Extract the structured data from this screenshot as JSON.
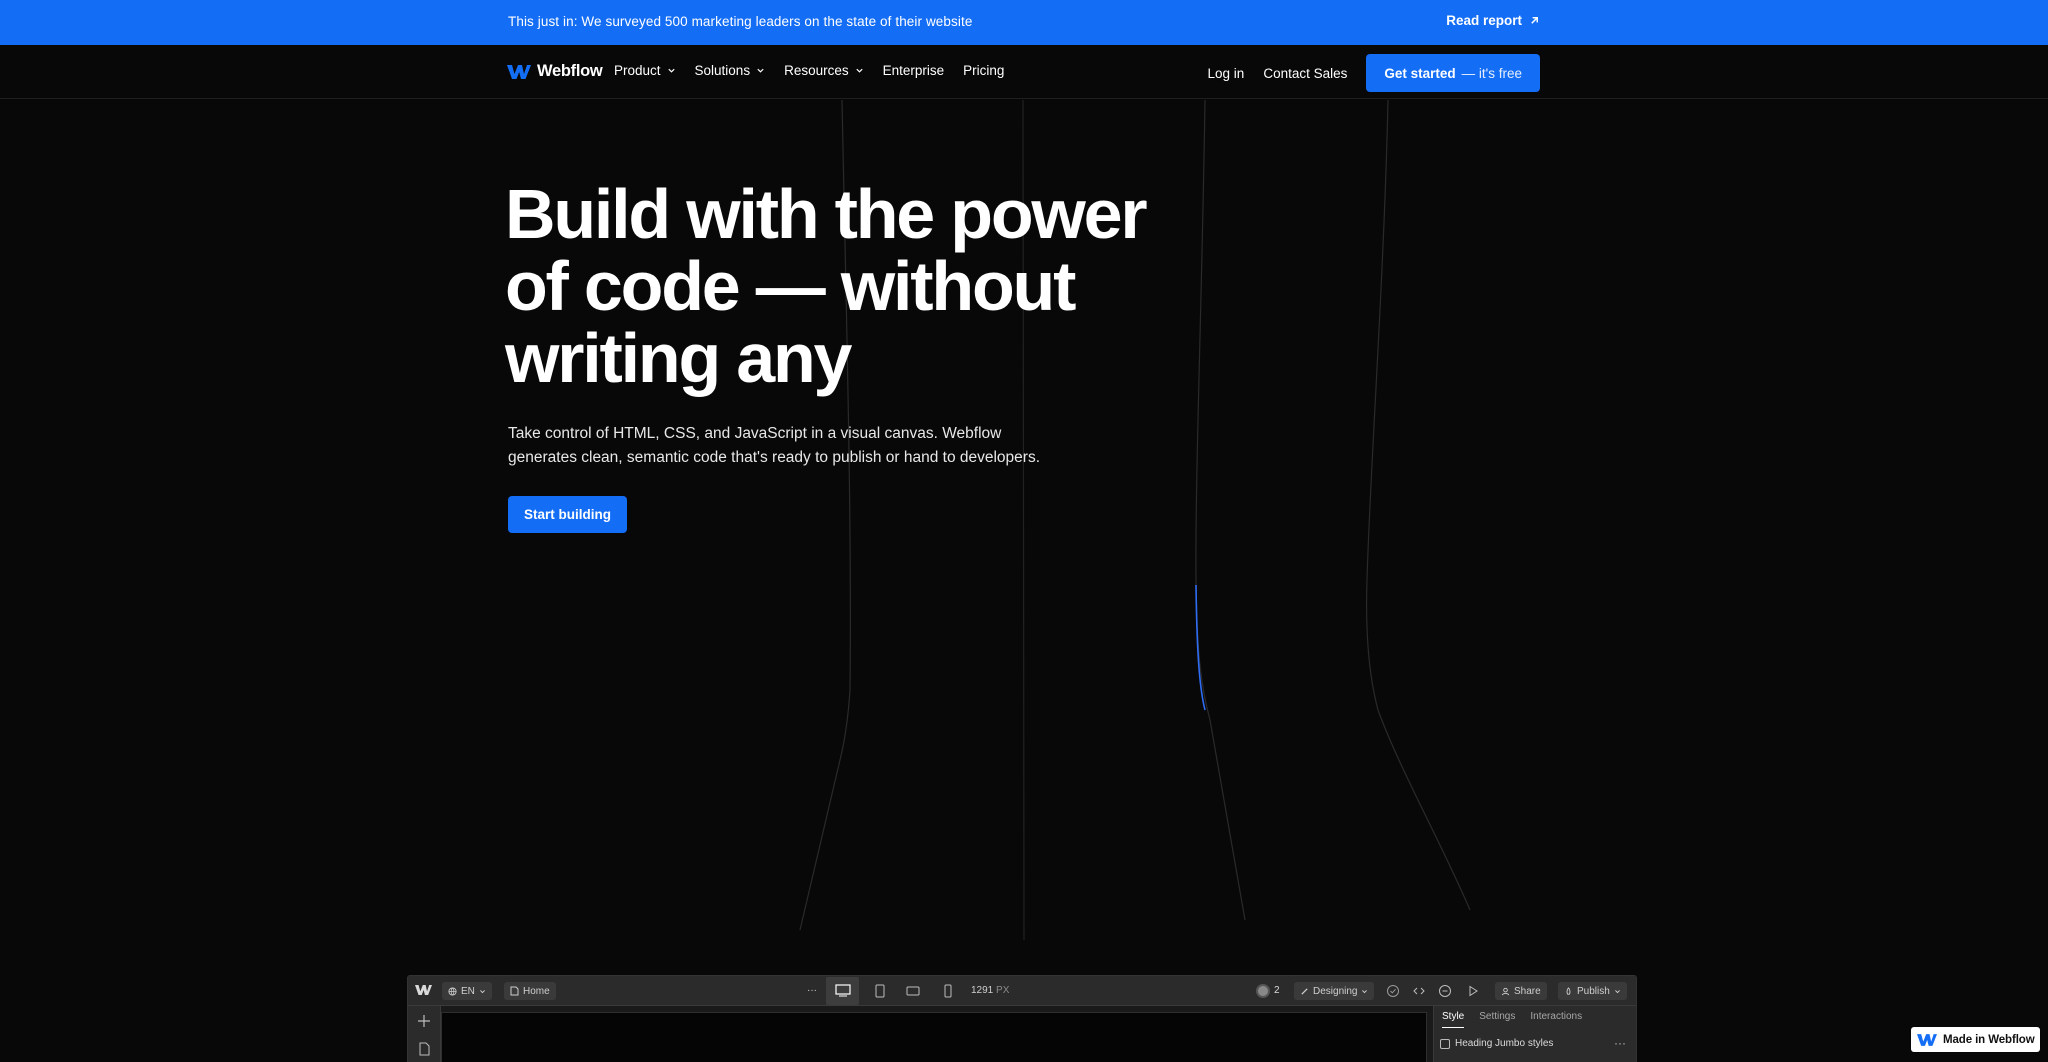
{
  "announcement": {
    "text": "This just in: We surveyed 500 marketing leaders on the state of their website",
    "link_label": "Read report",
    "link_icon": "arrow-up-right-icon"
  },
  "nav": {
    "brand": "Webflow",
    "items": [
      {
        "label": "Product",
        "has_dropdown": true
      },
      {
        "label": "Solutions",
        "has_dropdown": true
      },
      {
        "label": "Resources",
        "has_dropdown": true
      },
      {
        "label": "Enterprise",
        "has_dropdown": false
      },
      {
        "label": "Pricing",
        "has_dropdown": false
      }
    ],
    "login": "Log in",
    "contact": "Contact Sales",
    "cta_strong": "Get started",
    "cta_light": "— it's free"
  },
  "hero": {
    "title": "Build with the power\nof code — without\nwriting any",
    "subtitle": "Take control of HTML, CSS, and JavaScript in a visual canvas. Webflow generates clean, semantic code that's ready to publish or hand to developers.",
    "button": "Start building"
  },
  "designer": {
    "locale": "EN",
    "page": "Home",
    "more": "···",
    "width_value": "1291",
    "width_unit": "PX",
    "collaborators": "2",
    "mode": "Designing",
    "share": "Share",
    "publish": "Publish",
    "panel_tabs": [
      "Style",
      "Settings",
      "Interactions"
    ],
    "style_row": "Heading Jumbo styles",
    "row_more": "···"
  },
  "badge": {
    "label": "Made in Webflow"
  },
  "colors": {
    "accent": "#146ef5",
    "background": "#080808",
    "highlight_line": "#2f6df5"
  }
}
